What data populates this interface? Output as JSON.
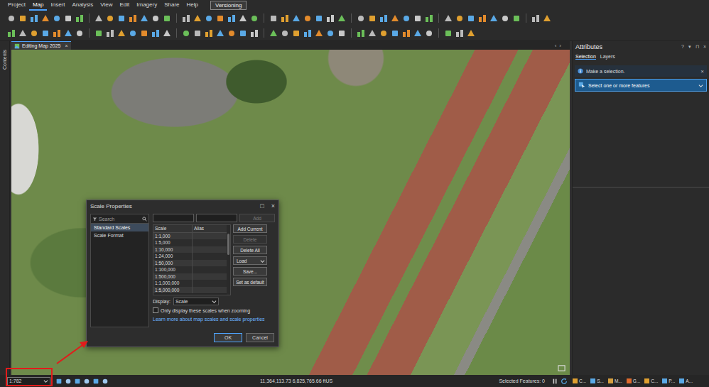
{
  "app": {
    "menu": [
      {
        "label": "Project",
        "selected": false
      },
      {
        "label": "Map",
        "selected": true
      },
      {
        "label": "Insert",
        "selected": false
      },
      {
        "label": "Analysis",
        "selected": false
      },
      {
        "label": "View",
        "selected": false
      },
      {
        "label": "Edit",
        "selected": false
      },
      {
        "label": "Imagery",
        "selected": false
      },
      {
        "label": "Share",
        "selected": false
      },
      {
        "label": "Help",
        "selected": false
      }
    ],
    "contextual_tab": {
      "label": "Versioning",
      "selected": false
    }
  },
  "contents_strip": {
    "label": "Contents"
  },
  "map_view": {
    "tab": {
      "title": "Editing Map 2025",
      "close": "×",
      "selected": true
    },
    "nav": [
      "‹",
      "›"
    ]
  },
  "dialog": {
    "title": "Scale Properties",
    "controls": [
      "□",
      "×"
    ],
    "search": {
      "placeholder": "Search"
    },
    "categories": [
      {
        "label": "Standard Scales",
        "selected": true
      },
      {
        "label": "Scale Format",
        "selected": false
      }
    ],
    "add_button": {
      "label": "Add",
      "disabled": true
    },
    "table": {
      "columns": [
        "Scale",
        "Alias"
      ],
      "rows": [
        {
          "scale": "1:1,000",
          "alias": ""
        },
        {
          "scale": "1:5,000",
          "alias": ""
        },
        {
          "scale": "1:10,000",
          "alias": ""
        },
        {
          "scale": "1:24,000",
          "alias": ""
        },
        {
          "scale": "1:50,000",
          "alias": ""
        },
        {
          "scale": "1:100,000",
          "alias": ""
        },
        {
          "scale": "1:500,000",
          "alias": ""
        },
        {
          "scale": "1:1,000,000",
          "alias": ""
        },
        {
          "scale": "1:5,000,000",
          "alias": ""
        }
      ]
    },
    "buttons": [
      {
        "label": "Add Current",
        "kind": "button",
        "disabled": false
      },
      {
        "label": "Delete",
        "kind": "button",
        "disabled": true
      },
      {
        "label": "Delete All",
        "kind": "button",
        "disabled": false
      },
      {
        "label": "Load",
        "kind": "dropdown",
        "disabled": false
      },
      {
        "label": "Save...",
        "kind": "button",
        "disabled": false
      },
      {
        "label": "Set as default",
        "kind": "button",
        "disabled": false
      }
    ],
    "display": {
      "label": "Display:",
      "value": "Scale"
    },
    "zoom_option": {
      "label": "Only display these scales when zooming",
      "checked": false
    },
    "link": "Learn more about map scales and scale properties",
    "footer": [
      {
        "label": "OK",
        "default": true
      },
      {
        "label": "Cancel",
        "default": false
      }
    ]
  },
  "status_bar": {
    "scale": {
      "value": "1:782",
      "highlighted": true
    },
    "coordinates": "11,364,113.73 6,825,765.66 ftUS",
    "selected_features": "Selected Features: 0"
  },
  "attributes": {
    "title": "Attributes",
    "controls": [
      "?",
      "▾",
      "⊓",
      "×"
    ],
    "tabs": [
      {
        "label": "Selection",
        "selected": true
      },
      {
        "label": "Layers",
        "selected": false
      }
    ],
    "message": {
      "text": "Make a selection.",
      "close": "×"
    },
    "picker": {
      "placeholder": "Select one or more features",
      "expanded": false
    }
  },
  "dock_tabs": [
    {
      "label": "C...",
      "color": "#e0a030"
    },
    {
      "label": "S...",
      "color": "#5aa9e6"
    },
    {
      "label": "M...",
      "color": "#d6a040"
    },
    {
      "label": "G...",
      "color": "#e06a2c"
    },
    {
      "label": "C...",
      "color": "#e0a030"
    },
    {
      "label": "P...",
      "color": "#5aa9e6"
    },
    {
      "label": "A...",
      "color": "#5aa9e6"
    }
  ]
}
